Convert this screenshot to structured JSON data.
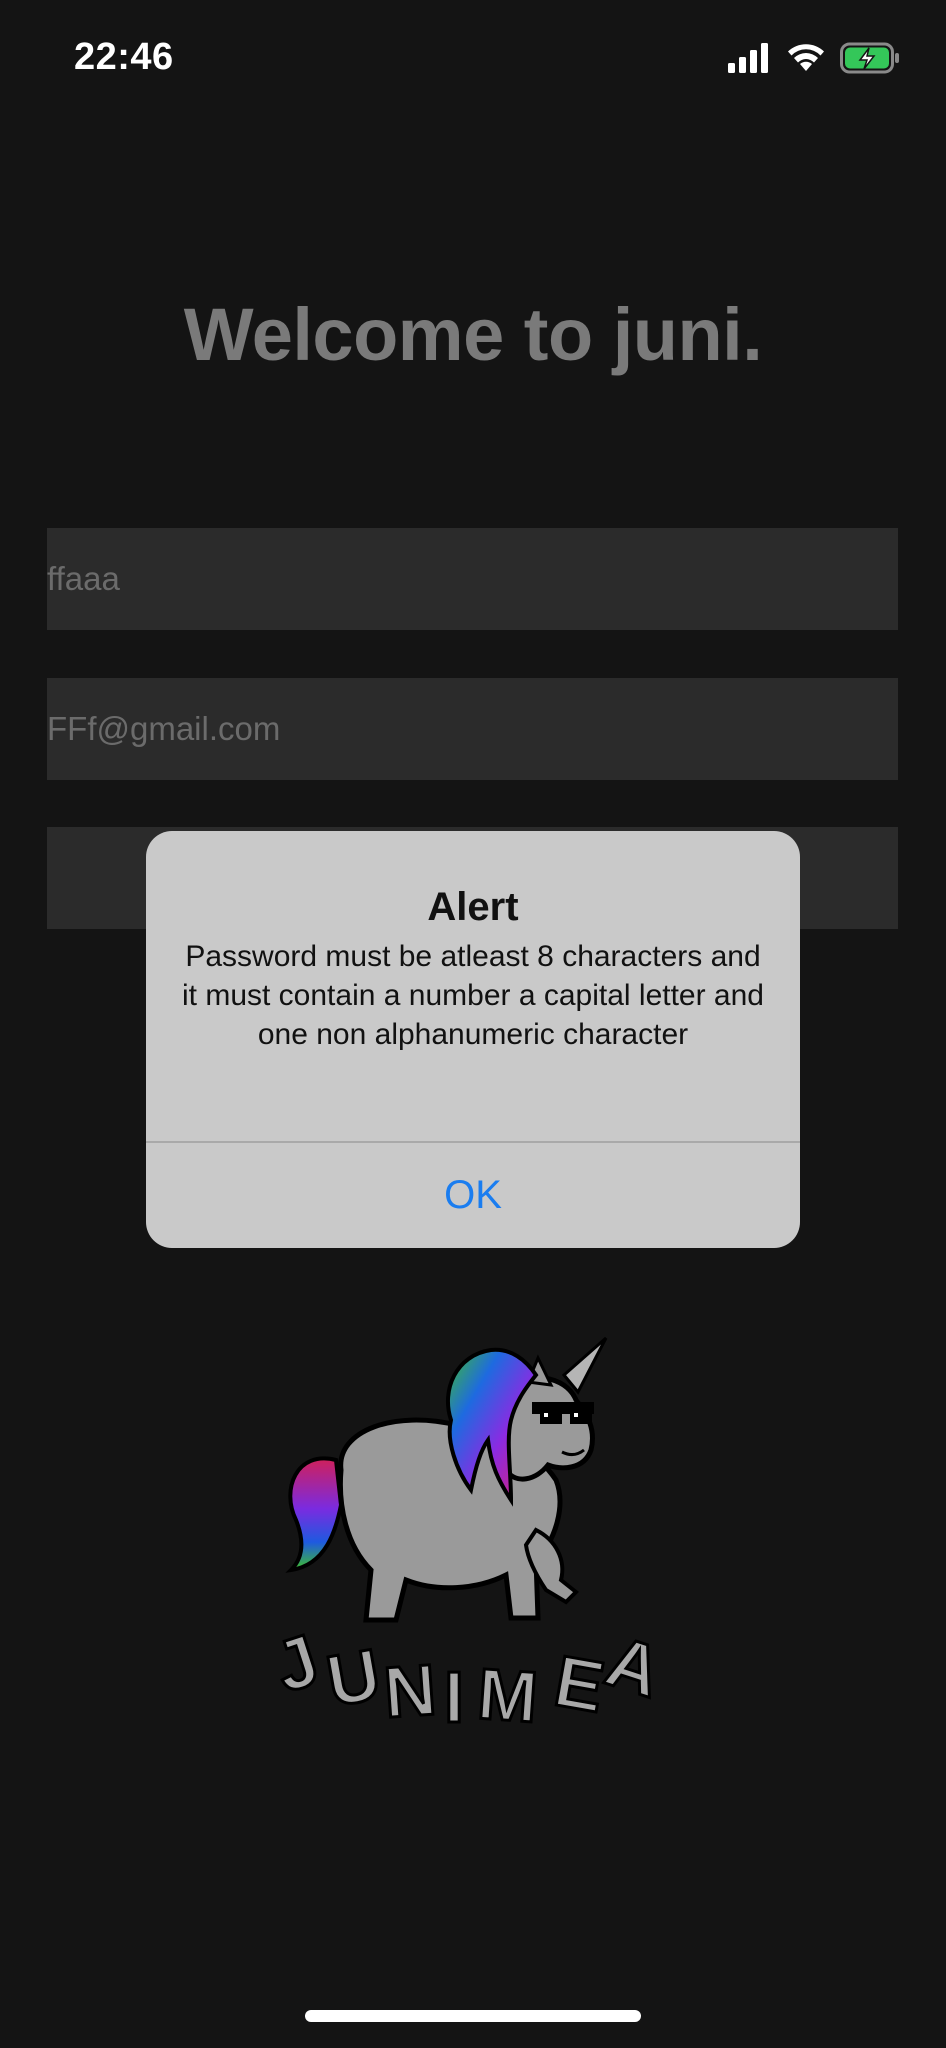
{
  "status_bar": {
    "time": "22:46"
  },
  "welcome": {
    "title": "Welcome to juni."
  },
  "form": {
    "username_value": "ffaaa",
    "email_value": "FFf@gmail.com",
    "password_value": ""
  },
  "alert": {
    "title": "Alert",
    "message": "Password must be atleast 8 characters and it must contain a number a capital letter and one non alphanumeric character",
    "ok_label": "OK"
  },
  "logo": {
    "text": "JUNIMEA"
  },
  "colors": {
    "background": "#141414",
    "field_background": "#2b2b2b",
    "alert_background": "#c9c9c9",
    "accent": "#1a7df0",
    "battery_green": "#34c759"
  },
  "icons": [
    "cellular-signal-icon",
    "wifi-icon",
    "battery-charging-icon"
  ]
}
